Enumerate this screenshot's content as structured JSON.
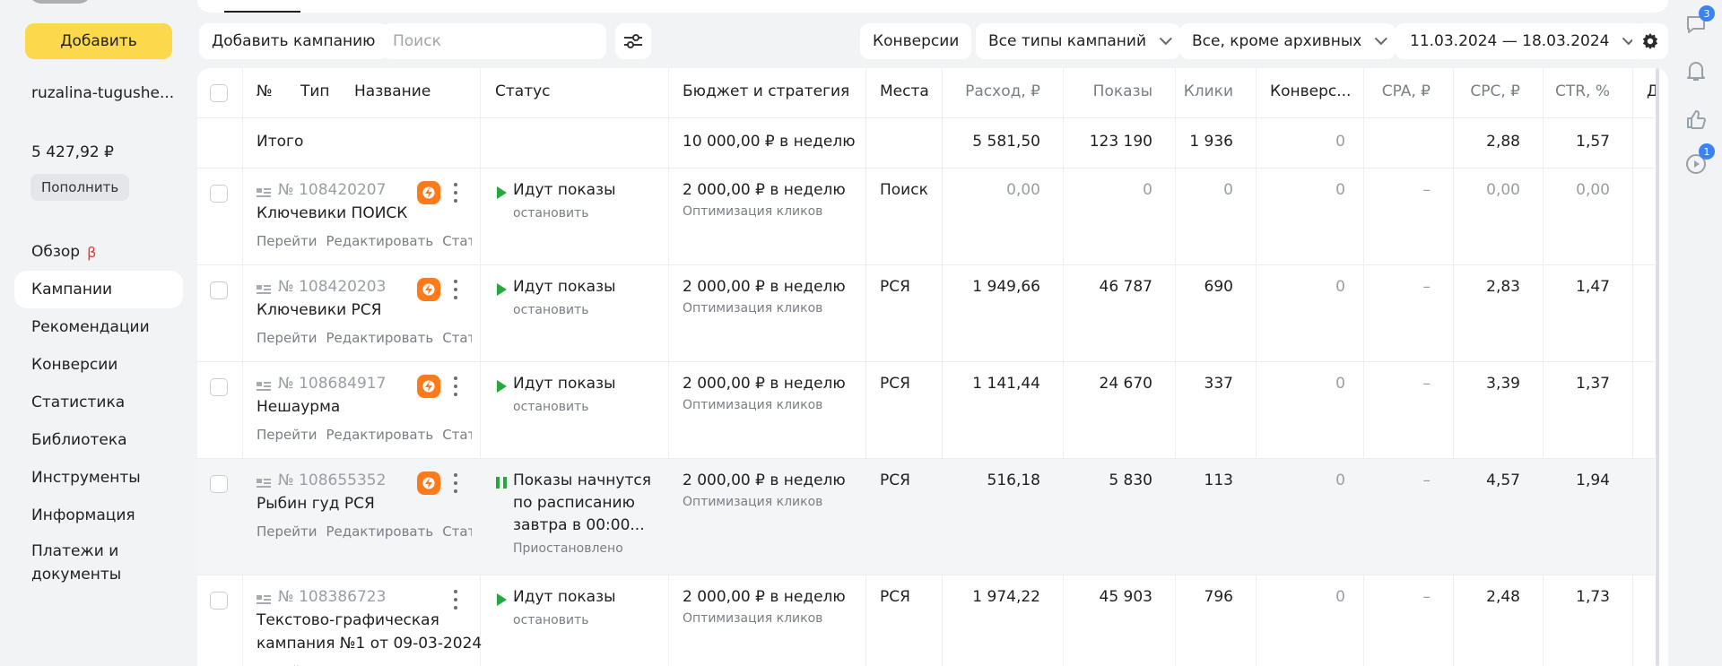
{
  "sidebar": {
    "add_button": "Добавить",
    "account": "ruzalina-tugushe...",
    "balance": "5 427,92 ₽",
    "topup": "Пополнить",
    "nav": [
      {
        "label": "Обзор",
        "badge": "β"
      },
      {
        "label": "Кампании",
        "active": true
      },
      {
        "label": "Рекомендации"
      },
      {
        "label": "Конверсии"
      },
      {
        "label": "Статистика"
      },
      {
        "label": "Библиотека"
      },
      {
        "label": "Инструменты"
      },
      {
        "label": "Информация"
      },
      {
        "label": "Платежи и документы"
      }
    ]
  },
  "toolbar": {
    "add_campaign": "Добавить кампанию",
    "search_placeholder": "Поиск",
    "conversions": "Конверсии",
    "campaign_types": "Все типы кампаний",
    "archive_filter": "Все, кроме архивных",
    "date_range": "11.03.2024 — 18.03.2024"
  },
  "table": {
    "headers": {
      "num": "№",
      "type": "Тип",
      "name": "Название",
      "status": "Статус",
      "budget": "Бюджет и стратегия",
      "places": "Места",
      "spend": "Расход, ₽",
      "impressions": "Показы",
      "clicks": "Клики",
      "conversions": "Конверс...",
      "cpa": "CPA, ₽",
      "cpc": "CPC, ₽",
      "ctr": "CTR, %",
      "extra": "Д"
    },
    "total": {
      "label": "Итого",
      "budget": "10 000,00 ₽ в неделю",
      "spend": "5 581,50",
      "impressions": "123 190",
      "clicks": "1 936",
      "conversions": "0",
      "cpc": "2,88",
      "ctr": "1,57"
    },
    "actions": [
      "Перейти",
      "Редактировать",
      "Статистика"
    ],
    "rows": [
      {
        "id": "№ 108420207",
        "name": [
          "Ключевики ПОИСК"
        ],
        "badge": true,
        "status": [
          "Идут показы"
        ],
        "status_sub": "остановить",
        "status_icon": "play",
        "budget": "2 000,00 ₽ в неделю",
        "strategy": "Оптимизация кликов",
        "places": "Поиск",
        "spend": "0,00",
        "impressions": "0",
        "clicks": "0",
        "conversions": "0",
        "cpa": "–",
        "cpc": "0,00",
        "ctr": "0,00",
        "zero": true
      },
      {
        "id": "№ 108420203",
        "name": [
          "Ключевики РСЯ"
        ],
        "badge": true,
        "status": [
          "Идут показы"
        ],
        "status_sub": "остановить",
        "status_icon": "play",
        "budget": "2 000,00 ₽ в неделю",
        "strategy": "Оптимизация кликов",
        "places": "РСЯ",
        "spend": "1 949,66",
        "impressions": "46 787",
        "clicks": "690",
        "conversions": "0",
        "cpa": "–",
        "cpc": "2,83",
        "ctr": "1,47"
      },
      {
        "id": "№ 108684917",
        "name": [
          "Нешаурма"
        ],
        "badge": true,
        "status": [
          "Идут показы"
        ],
        "status_sub": "остановить",
        "status_icon": "play",
        "budget": "2 000,00 ₽ в неделю",
        "strategy": "Оптимизация кликов",
        "places": "РСЯ",
        "spend": "1 141,44",
        "impressions": "24 670",
        "clicks": "337",
        "conversions": "0",
        "cpa": "–",
        "cpc": "3,39",
        "ctr": "1,37"
      },
      {
        "id": "№ 108655352",
        "name": [
          "Рыбин гуд РСЯ"
        ],
        "badge": true,
        "status": [
          "Показы начнутся",
          "по расписанию",
          "завтра в 00:00..."
        ],
        "status_sub": "Приостановлено",
        "status_icon": "pause",
        "budget": "2 000,00 ₽ в неделю",
        "strategy": "Оптимизация кликов",
        "places": "РСЯ",
        "spend": "516,18",
        "impressions": "5 830",
        "clicks": "113",
        "conversions": "0",
        "cpa": "–",
        "cpc": "4,57",
        "ctr": "1,94",
        "highlight": true
      },
      {
        "id": "№ 108386723",
        "name": [
          "Текстово-графическая",
          "кампания №1 от 09-03-2024"
        ],
        "badge": false,
        "status": [
          "Идут показы"
        ],
        "status_sub": "остановить",
        "status_icon": "play",
        "budget": "2 000,00 ₽ в неделю",
        "strategy": "Оптимизация кликов",
        "places": "РСЯ",
        "spend": "1 974,22",
        "impressions": "45 903",
        "clicks": "796",
        "conversions": "0",
        "cpa": "–",
        "cpc": "2,48",
        "ctr": "1,73"
      }
    ]
  },
  "rail": {
    "chat_badge": "3",
    "video_badge": "1"
  }
}
